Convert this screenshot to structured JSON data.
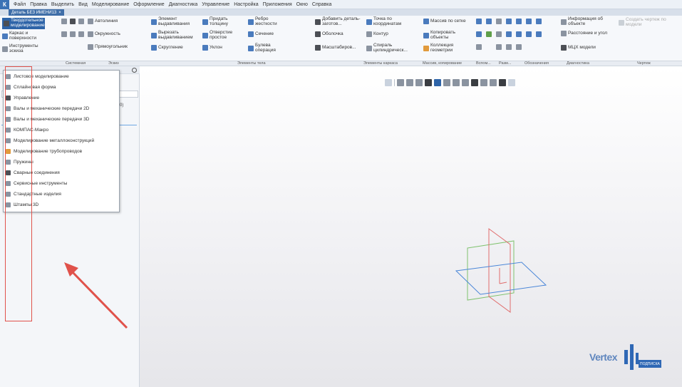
{
  "menubar": [
    "Файл",
    "Правка",
    "Выделить",
    "Вид",
    "Моделирование",
    "Оформление",
    "Диагностика",
    "Управление",
    "Настройка",
    "Приложения",
    "Окно",
    "Справка"
  ],
  "document_tab": "Деталь БЕЗ ИМЕНИ13",
  "left_tools": [
    "Твердотельное моделирование",
    "Каркас и поверхности",
    "Инструменты эскиза"
  ],
  "ribbon": {
    "col_sketch": [
      "Автолиния",
      "Окружность",
      "Прямоугольник"
    ],
    "col_ops1": [
      "Элемент выдавливания",
      "Вырезать выдавливанием",
      "Скругление"
    ],
    "col_ops2": [
      "Придать толщину",
      "Отверстие простое",
      "Уклон"
    ],
    "col_ops3": [
      "Ребро жесткости",
      "Сечение",
      "Булева операция"
    ],
    "col_ops4": [
      "Добавить деталь-заготов...",
      "Оболочка",
      "Масштабиров..."
    ],
    "col_frame": [
      "Точка по координатам",
      "Контур",
      "Спираль цилиндрическ..."
    ],
    "col_array": [
      "Массив по сетке",
      "Копировать объекты",
      "Коллекция геометрии"
    ],
    "col_diag": [
      "Информация об объекте",
      "Расстояние и угол",
      "МЦХ модели"
    ],
    "col_draw": "Создать чертеж по модели"
  },
  "group_labels": [
    "Системная",
    "Эскиз",
    "Элементы тела",
    "Элементы каркаса",
    "Массив, копирование",
    "Вспом...",
    "Разм...",
    "Обозначения",
    "Диагностика",
    "Чертеж"
  ],
  "popup_items": [
    "Листовое моделирование",
    "Сплайновая форма",
    "Управление",
    "Валы и механические передачи 2D",
    "Валы и механические передачи 3D",
    "КОМПАС-Макро",
    "Моделирование металлоконструкций",
    "Моделирование трубопроводов",
    "Пружины",
    "Сварные соединения",
    "Сервисные инструменты",
    "Стандартные изделия",
    "Штампы 3D"
  ],
  "left_panel": {
    "row_text": "0)"
  },
  "logo": {
    "text": "Vertex",
    "badge": "ПОДПИСКА"
  },
  "colors": {
    "highlight": "#e0524b",
    "brand": "#2f68b5",
    "plane_red": "#e06c6c",
    "plane_blue": "#4a86d8",
    "plane_green": "#7fc26e"
  }
}
